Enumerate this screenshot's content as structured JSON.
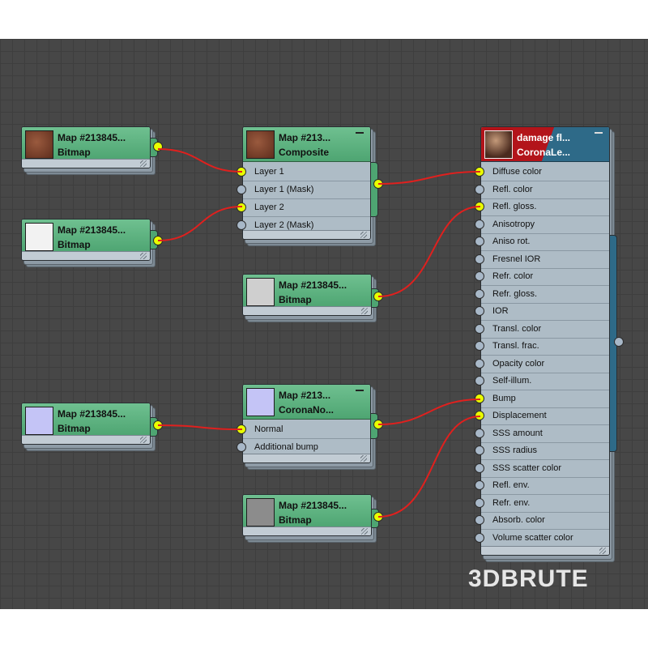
{
  "nodes": {
    "bitmap_a": {
      "title": "Map  #213845...",
      "type": "Bitmap"
    },
    "bitmap_b": {
      "title": "Map  #213845...",
      "type": "Bitmap"
    },
    "composite": {
      "title": "Map  #213...",
      "type": "Composite",
      "slots": [
        "Layer 1",
        "Layer 1 (Mask)",
        "Layer 2",
        "Layer 2 (Mask)"
      ]
    },
    "bitmap_c": {
      "title": "Map  #213845...",
      "type": "Bitmap"
    },
    "bitmap_d": {
      "title": "Map  #213845...",
      "type": "Bitmap"
    },
    "corona_normal": {
      "title": "Map  #213...",
      "type": "CoronaNo...",
      "slots": [
        "Normal",
        "Additional bump"
      ]
    },
    "bitmap_e": {
      "title": "Map  #213845...",
      "type": "Bitmap"
    },
    "material": {
      "title": "damage  fl...",
      "type": "CoronaLe...",
      "slots": [
        "Diffuse color",
        "Refl. color",
        "Refl. gloss.",
        "Anisotropy",
        "Aniso rot.",
        "Fresnel IOR",
        "Refr. color",
        "Refr. gloss.",
        "IOR",
        "Transl. color",
        "Transl. frac.",
        "Opacity color",
        "Self-illum.",
        "Bump",
        "Displacement",
        "SSS amount",
        "SSS radius",
        "SSS scatter color",
        "Refl. env.",
        "Refr. env.",
        "Absorb. color",
        "Volume scatter color"
      ]
    }
  },
  "watermark": "3DBRUTE",
  "colors": {
    "wire": "#e0201e",
    "port_active": "#e9ff00",
    "node_header": "#5db37f",
    "material_header": "#2e6a88"
  }
}
